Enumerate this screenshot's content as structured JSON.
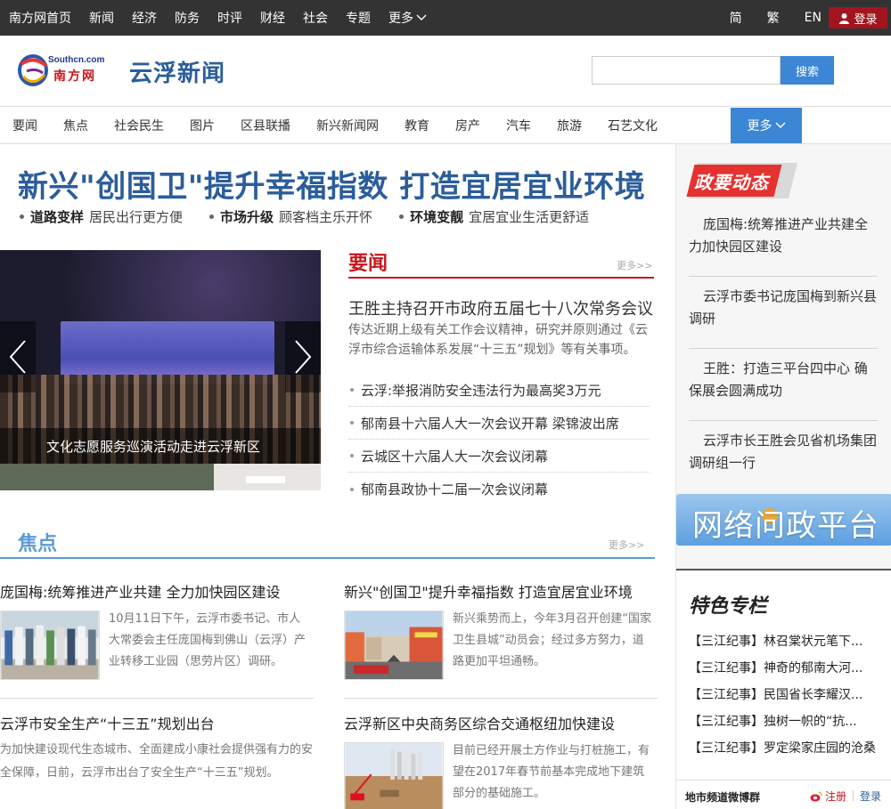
{
  "topbar": {
    "nav": [
      "南方网首页",
      "新闻",
      "经济",
      "防务",
      "时评",
      "财经",
      "社会",
      "专题"
    ],
    "more_label": "更多",
    "lang": [
      "简",
      "繁",
      "EN"
    ],
    "login_label": "登录"
  },
  "header": {
    "logo_en": "Southcn.com",
    "logo_cn": "南方网",
    "site_title": "云浮新闻",
    "search_value": "",
    "search_button": "搜索"
  },
  "nav": {
    "items": [
      "要闻",
      "焦点",
      "社会民生",
      "图片",
      "区县联播",
      "新兴新闻网",
      "教育",
      "房产",
      "汽车",
      "旅游",
      "石艺文化"
    ],
    "more_label": "更多"
  },
  "headline": {
    "title": "新兴\"创国卫\"提升幸福指数 打造宜居宜业环境",
    "subs": [
      {
        "bold": "道路变样",
        "text": "居民出行更方便"
      },
      {
        "bold": "市场升级",
        "text": "顾客档主乐开怀"
      },
      {
        "bold": "环境变靓",
        "text": "宜居宜业生活更舒适"
      }
    ]
  },
  "slider": {
    "caption": "文化志愿服务巡演活动走进云浮新区"
  },
  "yaowen": {
    "title": "要闻",
    "more": "更多>>",
    "main_title": "王胜主持召开市政府五届七十八次常务会议",
    "main_desc": "传达近期上级有关工作会议精神，研究并原则通过《云浮市综合运输体系发展“十三五”规划》等有关事项。",
    "items": [
      "云浮:举报消防安全违法行为最高奖3万元",
      "郁南县十六届人大一次会议开幕 梁锦波出席",
      "云城区十六届人大一次会议闭幕",
      "郁南县政协十二届一次会议闭幕"
    ]
  },
  "jiaodian": {
    "title": "焦点",
    "more": "更多>>",
    "cards": [
      {
        "title": "庞国梅:统筹推进产业共建 全力加快园区建设",
        "text": "10月11日下午，云浮市委书记、市人大常委会主任庞国梅到佛山（云浮）产业转移工业园（思劳片区）调研。"
      },
      {
        "title": "新兴\"创国卫\"提升幸福指数 打造宜居宜业环境",
        "text": "新兴乘势而上，今年3月召开创建“国家卫生县城”动员会；经过多方努力，道路更加平坦通畅。"
      },
      {
        "title": "云浮市安全生产“十三五”规划出台",
        "text": "为加快建设现代生态城市、全面建成小康社会提供强有力的安全保障，日前，云浮市出台了安全生产“十三五”规划。"
      },
      {
        "title": "云浮新区中央商务区综合交通枢纽加快建设",
        "text": "目前已经开展土方作业与打桩施工，有望在2017年春节前基本完成地下建筑部分的基础施工。"
      }
    ]
  },
  "right": {
    "zhengyao_title": "政要动态",
    "zhengyao": [
      "庞国梅:统筹推进产业共建全力加快园区建设",
      "云浮市委书记庞国梅到新兴县调研",
      "王胜：打造三平台四中心 确保展会圆满成功",
      "云浮市长王胜会见省机场集团调研组一行"
    ],
    "wenzheng": "网络问政平台",
    "tese_title": "特色专栏",
    "tese": [
      "【三江纪事】林召棠状元笔下...",
      "【三江纪事】神奇的郁南大河...",
      "【三江纪事】民国省长李耀汉...",
      "【三江纪事】独树一帜的“抗...",
      "【三江纪事】罗定梁家庄园的沧桑"
    ],
    "weibo_label": "地市频道微博群",
    "weibo_register": "注册",
    "weibo_login": "登录"
  },
  "colors": {
    "topbar_bg": "#333333",
    "brand_blue": "#2b5d9b",
    "accent_blue": "#3c86d6",
    "brand_red": "#c8161d"
  }
}
